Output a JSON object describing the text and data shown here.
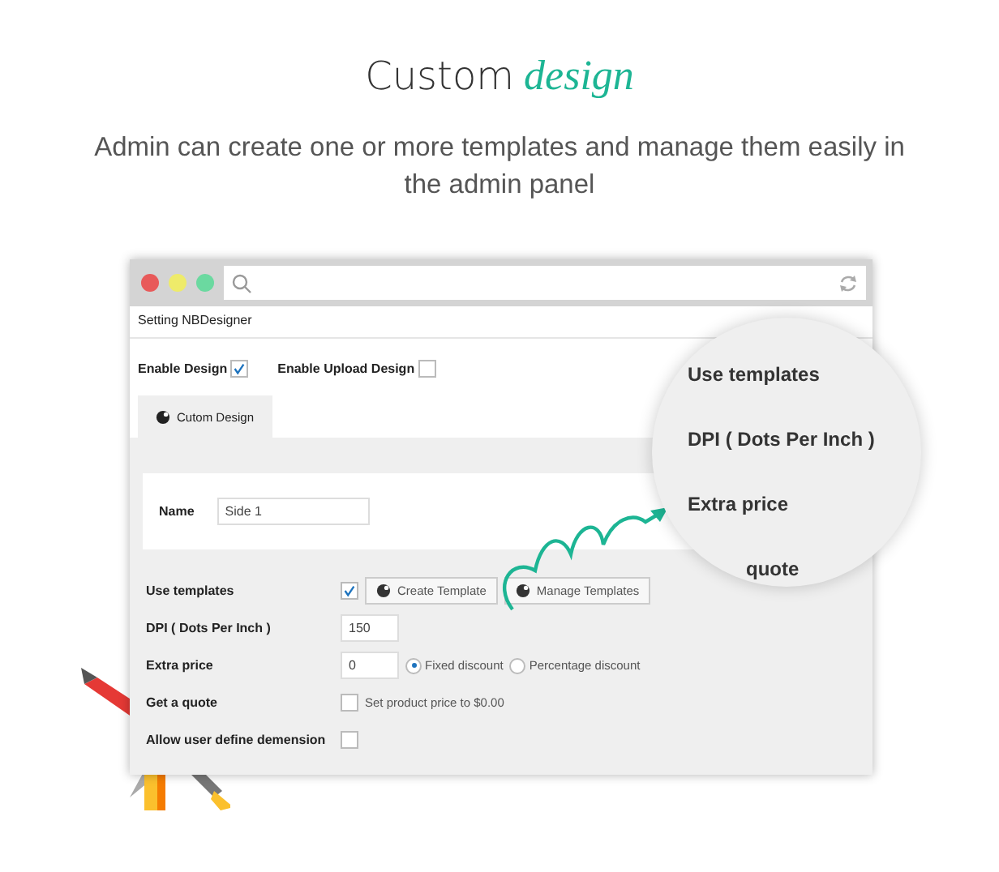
{
  "heading": {
    "text": "Custom",
    "accent": "design"
  },
  "subtitle": "Admin can create one or more templates and manage them easily in the admin panel",
  "window": {
    "title": "Setting NBDesigner",
    "toggles": [
      {
        "label": "Enable Design",
        "checked": true
      },
      {
        "label": "Enable Upload Design",
        "checked": false
      }
    ],
    "tabs": [
      {
        "label": "Cutom Design",
        "selected": true
      }
    ],
    "name_field": {
      "label": "Name",
      "value": "Side 1"
    },
    "settings": [
      {
        "kind": "buttons",
        "label": "Use templates",
        "checked": true,
        "buttons": [
          "Create Template",
          "Manage Templates"
        ]
      },
      {
        "kind": "input",
        "label": "DPI ( Dots Per Inch )",
        "value": "150"
      },
      {
        "kind": "radios",
        "label": "Extra price",
        "value": "0",
        "options": [
          {
            "label": "Fixed discount",
            "selected": true
          },
          {
            "label": "Percentage discount",
            "selected": false
          }
        ]
      },
      {
        "kind": "check",
        "label": "Get a quote",
        "checked": false,
        "text": "Set product price to $0.00"
      },
      {
        "kind": "check",
        "label": "Allow user define demension",
        "checked": false
      }
    ]
  },
  "magnifier": [
    "Use templates",
    "DPI ( Dots Per Inch )",
    "Extra price",
    "quote"
  ]
}
